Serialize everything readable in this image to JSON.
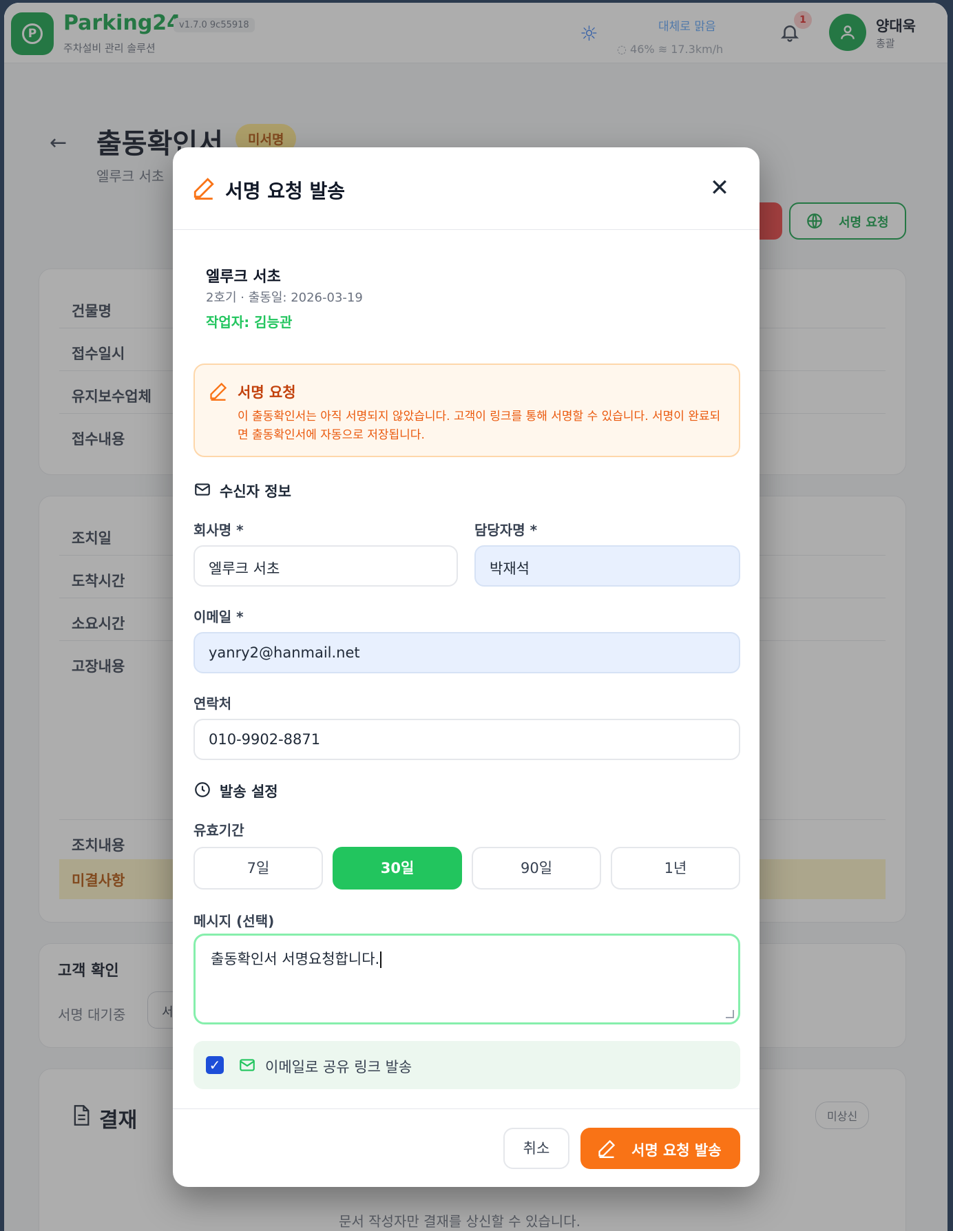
{
  "app": {
    "brand": "Parking24",
    "subtitle": "주차설비 관리 솔루션",
    "version": "v1.7.0 9c55918",
    "weather": {
      "condition": "대체로 맑음",
      "details": "◌ 46%   ≋ 17.3km/h"
    },
    "notifications": {
      "count": "1"
    },
    "user": {
      "name": "양대욱",
      "role": "총괄"
    }
  },
  "page": {
    "title": "출동확인서",
    "status_badge": "미서명",
    "subtitle": "엘루크 서초",
    "sign_request_button": "서명 요청",
    "fields_top": [
      "건물명",
      "접수일시",
      "유지보수업체",
      "접수내용"
    ],
    "fields_mid": [
      "조치일",
      "도착시간",
      "소요시간",
      "고장내용"
    ],
    "fields_bottom": [
      "조치내용"
    ],
    "unresolved_label": "미결사항",
    "customer_confirm": {
      "title": "고객 확인",
      "status": "서명 대기중",
      "button": "서"
    },
    "payment": {
      "title": "결재",
      "badge": "미상신",
      "note": "문서 작성자만 결재를 상신할 수 있습니다."
    }
  },
  "modal": {
    "title": "서명 요청 발송",
    "summary": {
      "company": "엘루크 서초",
      "meta": "2호기 · 출동일: 2026-03-19",
      "worker": "작업자: 김능관"
    },
    "alert": {
      "title": "서명 요청",
      "body": "이 출동확인서는 아직 서명되지 않았습니다. 고객이 링크를 통해 서명할 수 있습니다. 서명이 완료되면 출동확인서에 자동으로 저장됩니다."
    },
    "recipient_section": "수신자 정보",
    "company_label": "회사명 *",
    "company_value": "엘루크 서초",
    "contact_label": "담당자명 *",
    "contact_value": "박재석",
    "email_label": "이메일 *",
    "email_value": "yanry2@hanmail.net",
    "phone_label": "연락처",
    "phone_value": "010-9902-8871",
    "send_section": "발송 설정",
    "validity_label": "유효기간",
    "validity_options": [
      "7일",
      "30일",
      "90일",
      "1년"
    ],
    "validity_selected": "30일",
    "message_label": "메시지 (선택)",
    "message_value": "출동확인서 서명요청합니다.",
    "share_email_checked": true,
    "share_email_label": "이메일로 공유 링크 발송",
    "cancel_button": "취소",
    "send_button": "서명 요청 발송"
  },
  "colors": {
    "brand_green": "#16a34a",
    "active_green": "#22c55e",
    "accent_orange": "#f97316",
    "checkbox_blue": "#1d4ed8"
  }
}
